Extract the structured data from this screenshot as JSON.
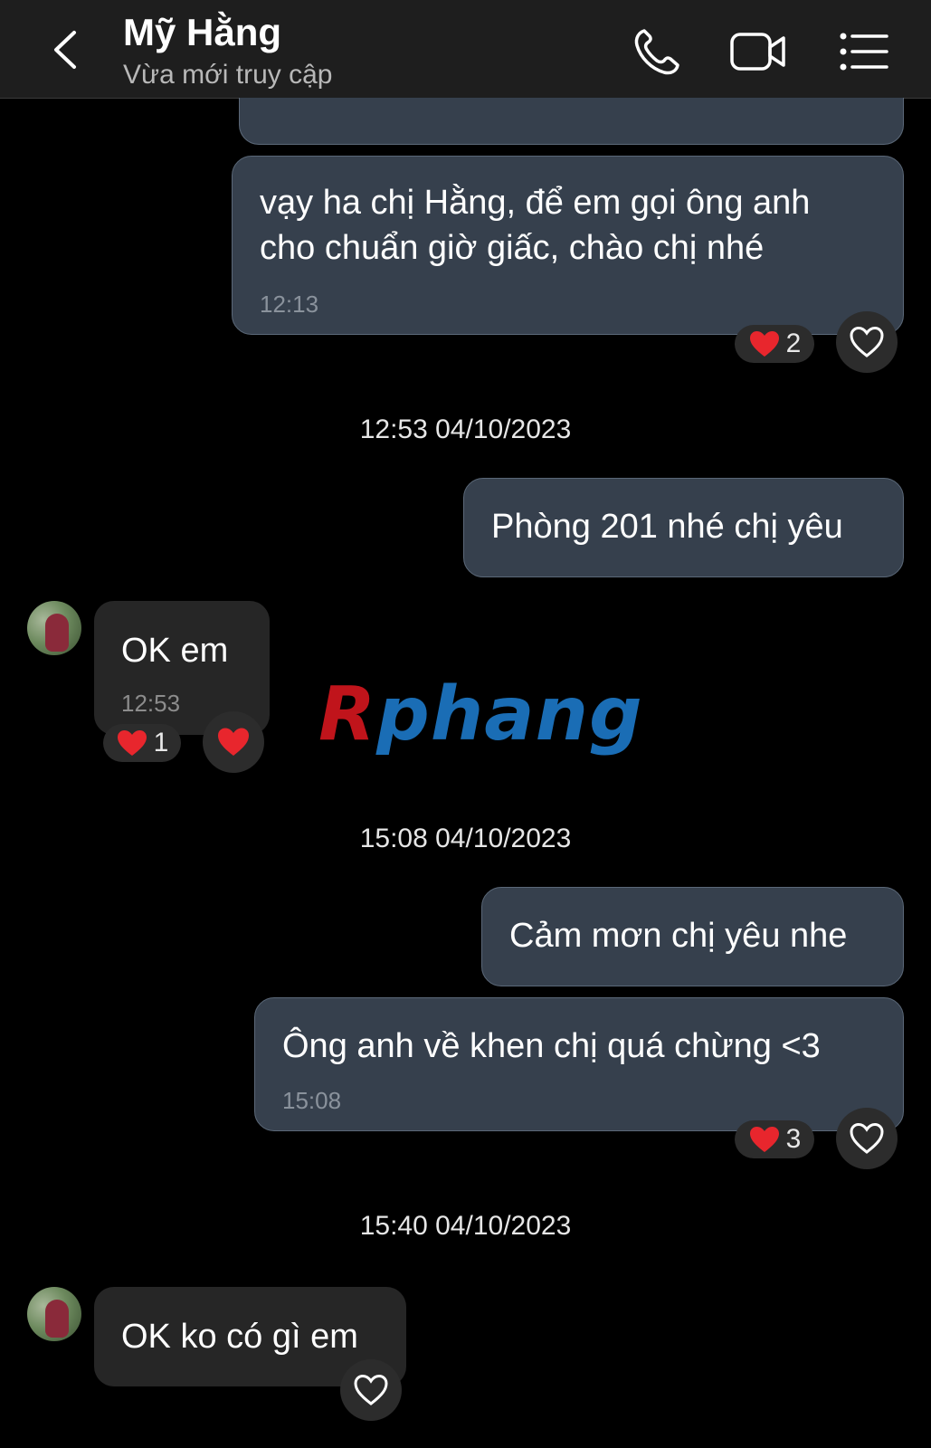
{
  "header": {
    "name": "Mỹ Hằng",
    "status": "Vừa mới truy cập"
  },
  "messages": [
    {
      "line1": "vạy ha chị Hằng, để em gọi ông anh",
      "line2": "cho chuẩn giờ giấc, chào chị nhé",
      "time": "12:13",
      "reaction_count": "2"
    },
    {
      "text": "Phòng 201 nhé chị yêu"
    },
    {
      "text": "OK em",
      "time": "12:53",
      "reaction_count": "1"
    },
    {
      "text": "Cảm mơn chị yêu nhe"
    },
    {
      "text": "Ông anh về khen chị quá chừng <3",
      "time": "15:08",
      "reaction_count": "3"
    },
    {
      "text": "OK ko có gì em"
    }
  ],
  "dates": [
    "12:53 04/10/2023",
    "15:08 04/10/2023",
    "15:40 04/10/2023"
  ],
  "watermark": {
    "part1": "R",
    "part2": "phang"
  },
  "colors": {
    "bubble_out": "#36404d",
    "bubble_in": "#262626",
    "heart": "#e8262d"
  }
}
